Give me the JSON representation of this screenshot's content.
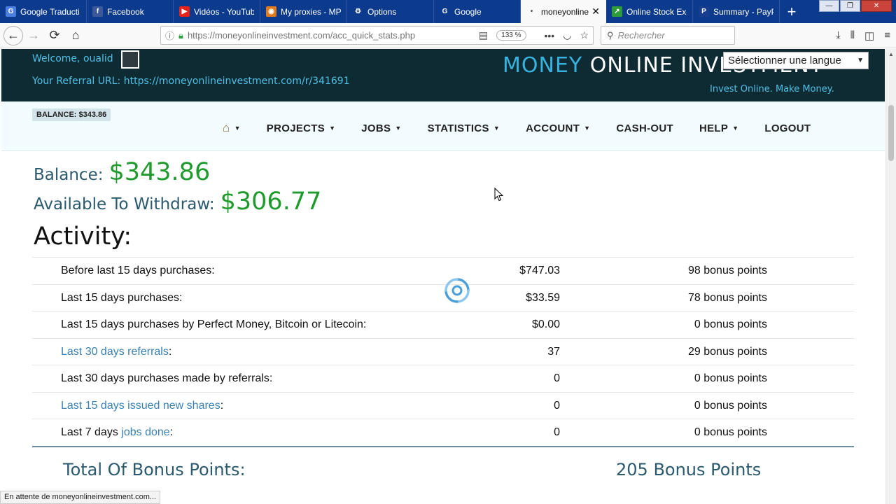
{
  "browser": {
    "tabs": [
      {
        "title": "Google Traducti",
        "icon": "google-translate-icon",
        "color": "#4a7fe0",
        "glyph": "G"
      },
      {
        "title": "Facebook",
        "icon": "facebook-icon",
        "color": "#3b5998",
        "glyph": "f"
      },
      {
        "title": "Vidéos - YouTub",
        "icon": "youtube-icon",
        "color": "#e62117",
        "glyph": "▶"
      },
      {
        "title": "My proxies - MP",
        "icon": "proxies-icon",
        "color": "#e07a1f",
        "glyph": "◉"
      },
      {
        "title": "Options",
        "icon": "gear-icon",
        "color": "#ffffff",
        "glyph": "⚙"
      },
      {
        "title": "Google",
        "icon": "google-icon",
        "color": "#ffffff",
        "glyph": "G"
      },
      {
        "title": "moneyonline",
        "icon": "loading-dot-icon",
        "color": "#f9f9fa",
        "glyph": "•",
        "active": true
      },
      {
        "title": "Online Stock Exc",
        "icon": "stock-chart-icon",
        "color": "#2d9b3a",
        "glyph": "↗"
      },
      {
        "title": "Summary - PayP",
        "icon": "paypal-icon",
        "color": "#1a3e8f",
        "glyph": "P"
      }
    ],
    "url": "https://moneyonlineinvestment.com/acc_quick_stats.php",
    "zoom": "133 %",
    "search_placeholder": "Rechercher",
    "status_text": "En attente de moneyonlineinvestment.com..."
  },
  "header": {
    "welcome": "Welcome, oualid",
    "referral": "Your Referral URL: https://moneyonlineinvestment.com/r/341691",
    "brand_part1": "MONEY",
    "brand_part2": " ONLINE INVESTMENT",
    "tagline": "Invest Online. Make Money.",
    "language_select": "Sélectionner une langue"
  },
  "nav": {
    "balance_badge": "BALANCE: $343.86",
    "items": [
      "PROJECTS",
      "JOBS",
      "STATISTICS",
      "ACCOUNT",
      "CASH-OUT",
      "HELP",
      "LOGOUT"
    ]
  },
  "summary": {
    "balance_label": "Balance:",
    "balance_value": "$343.86",
    "withdraw_label": "Available To Withdraw:",
    "withdraw_value": "$306.77"
  },
  "activity": {
    "heading": "Activity:",
    "rows": [
      {
        "pre": "Before last 15 days purchases:",
        "link": "",
        "post": "",
        "amount": "$747.03",
        "points": "98 bonus points"
      },
      {
        "pre": "Last 15 days purchases:",
        "link": "",
        "post": "",
        "amount": "$33.59",
        "points": "78 bonus points"
      },
      {
        "pre": "Last 15 days purchases by Perfect Money, Bitcoin or Litecoin:",
        "link": "",
        "post": "",
        "amount": "$0.00",
        "points": "0 bonus points"
      },
      {
        "pre": "",
        "link": "Last 30 days referrals",
        "post": ":",
        "amount": "37",
        "points": "29 bonus points"
      },
      {
        "pre": "Last 30 days purchases made by referrals:",
        "link": "",
        "post": "",
        "amount": "0",
        "points": "0 bonus points"
      },
      {
        "pre": "",
        "link": "Last 15 days issued new shares",
        "post": ":",
        "amount": "0",
        "points": "0 bonus points"
      },
      {
        "pre": "Last 7 days ",
        "link": "jobs done",
        "post": ":",
        "amount": "0",
        "points": "0 bonus points"
      }
    ],
    "total_label": "Total Of Bonus Points:",
    "total_value": "205 Bonus Points"
  }
}
